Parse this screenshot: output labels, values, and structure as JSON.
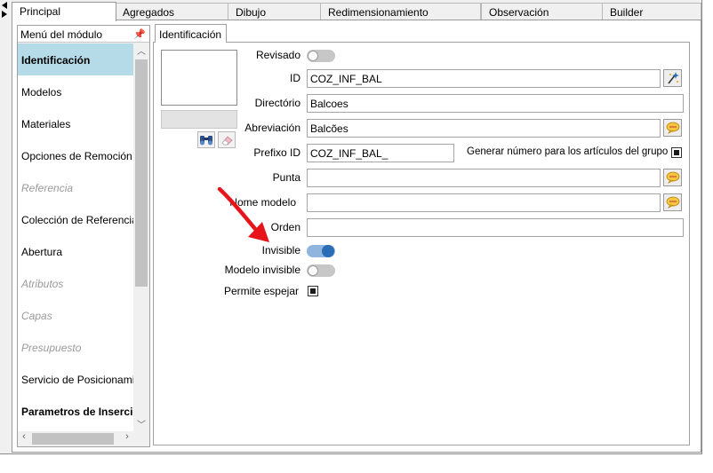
{
  "tabs": [
    "Principal",
    "Agregados",
    "Dibujo",
    "Redimensionamiento",
    "Observación",
    "Builder"
  ],
  "module_menu": {
    "header": "Menú del módulo",
    "items": [
      {
        "label": "Identificación",
        "state": "selected"
      },
      {
        "label": "Modelos",
        "state": "normal"
      },
      {
        "label": "Materiales",
        "state": "normal"
      },
      {
        "label": "Opciones de Remoción",
        "state": "normal"
      },
      {
        "label": "Referencia",
        "state": "disabled"
      },
      {
        "label": "Colección de Referencias",
        "state": "normal"
      },
      {
        "label": "Abertura",
        "state": "normal"
      },
      {
        "label": "Atributos",
        "state": "disabled"
      },
      {
        "label": "Capas",
        "state": "disabled"
      },
      {
        "label": "Presupuesto",
        "state": "disabled"
      },
      {
        "label": "Servicio de Posicionamie",
        "state": "normal"
      },
      {
        "label": "Parametros de Inserción",
        "state": "bold"
      }
    ]
  },
  "section_tab": "Identificación",
  "form": {
    "revisado_label": "Revisado",
    "id_label": "ID",
    "id_value": "COZ_INF_BAL",
    "directorio_label": "Directório",
    "directorio_value": "Balcoes",
    "abreviacion_label": "Abreviación",
    "abreviacion_value": "Balcões",
    "prefijo_label": "Prefixo ID",
    "prefijo_value": "COZ_INF_BAL_",
    "generar_label": "Generar número para los artículos del grupo",
    "punta_label": "Punta",
    "punta_value": "",
    "nome_modelo_label": "Nome modelo",
    "nome_modelo_value": "",
    "orden_label": "Orden",
    "orden_value": "",
    "invisible_label": "Invisible",
    "modelo_invisible_label": "Modelo invisible",
    "permite_espejar_label": "Permite espejar"
  },
  "states": {
    "revisado": false,
    "invisible": true,
    "modelo_invisible": false,
    "generar_numero": true,
    "permite_espejar": true
  },
  "colors": {
    "selected_menu_bg": "#b5dbe9",
    "toggle_on": "#2a6db6",
    "annotation_arrow": "#e8141b"
  }
}
